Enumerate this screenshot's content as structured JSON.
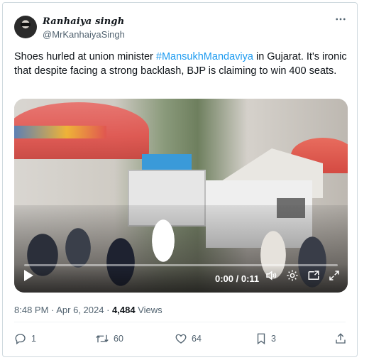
{
  "author": {
    "display_name": "Ranhaiya singh",
    "handle": "@MrKanhaiyaSingh"
  },
  "tweet": {
    "text_before": "Shoes hurled at union minister ",
    "hashtag": "#MansukhMandaviya",
    "text_after": " in Gujarat. It's ironic that despite facing a strong backlash, BJP is claiming  to win 400 seats."
  },
  "video": {
    "time_display": "0:00 / 0:11",
    "progress_fraction": 0.0
  },
  "meta": {
    "time": "8:48 PM",
    "separator1": " · ",
    "date": "Apr 6, 2024",
    "separator2": " · ",
    "views_count": "4,484",
    "views_label": " Views"
  },
  "actions": {
    "replies": "1",
    "retweets": "60",
    "likes": "64",
    "bookmarks": "3"
  },
  "icons": {
    "more": "more-horizontal-icon",
    "reply": "reply-icon",
    "retweet": "retweet-icon",
    "like": "heart-icon",
    "bookmark": "bookmark-icon",
    "share": "share-icon",
    "play": "play-icon",
    "volume": "volume-icon",
    "settings": "gear-icon",
    "pip": "picture-in-picture-icon",
    "fullscreen": "fullscreen-icon"
  },
  "colors": {
    "accent": "#1d9bf0",
    "secondary_text": "#536471",
    "primary_text": "#0f1419",
    "border": "#cfd9de"
  }
}
